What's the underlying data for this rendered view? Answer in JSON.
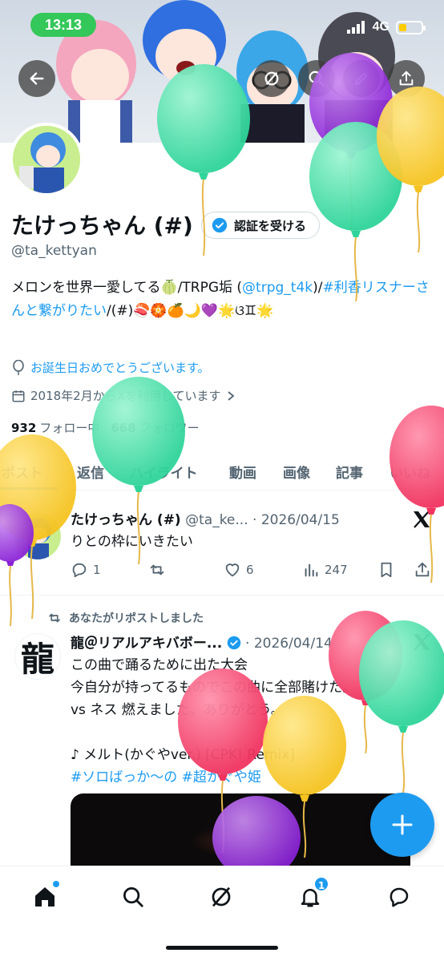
{
  "status_bar": {
    "time": "13:13",
    "network": "4G"
  },
  "profile": {
    "name": "たけっちゃん (#)",
    "handle": "@ta_kettyan",
    "verify_button": "認証を受ける",
    "bio": {
      "part1": "メロンを世界一愛してる🍈/TRPG垢 (",
      "mention": "@trpg_t4k",
      "part2": ")/",
      "hashtag": "#利香リスナーさんと繋がりたい",
      "part3": "/(#)🍣🏵️🍊🌙💜🌟ଓ♊🌟"
    },
    "birthday": "お誕生日おめでとうございます。",
    "joined": "2018年2月からXを利用しています",
    "following_count": "932",
    "following_label": "フォロー中",
    "followers_count": "668",
    "followers_label": "フォロワー"
  },
  "tabs": [
    "ポスト",
    "返信",
    "ハイライト",
    "動画",
    "画像",
    "記事",
    "いいね"
  ],
  "tweets": [
    {
      "name": "たけっちゃん (#)",
      "handle": "@ta_ke...",
      "date": "· 2026/04/15",
      "text": "りとの枠にいきたい",
      "replies": "1",
      "likes": "6",
      "views": "247"
    },
    {
      "repost_label": "あなたがリポストしました",
      "name": "龍＠リアルアキバボー...",
      "date": "· 2026/04/14",
      "avatar_char": "龍",
      "line1": "この曲で踊るために出た大会",
      "line2": "今自分が持ってるものでこの曲に全部賭けた。",
      "line3": "vs ネス 燃えました、ありがとう。",
      "line4": "♪ メルト(かぐやver.) [CPK! Remix]",
      "hashtags": "#ソロばっか～の #超かぐや姫"
    }
  ],
  "nav": {
    "notification_badge": "1"
  },
  "colors": {
    "accent": "#1d9bf0",
    "text": "#0f1419",
    "muted": "#536471"
  }
}
